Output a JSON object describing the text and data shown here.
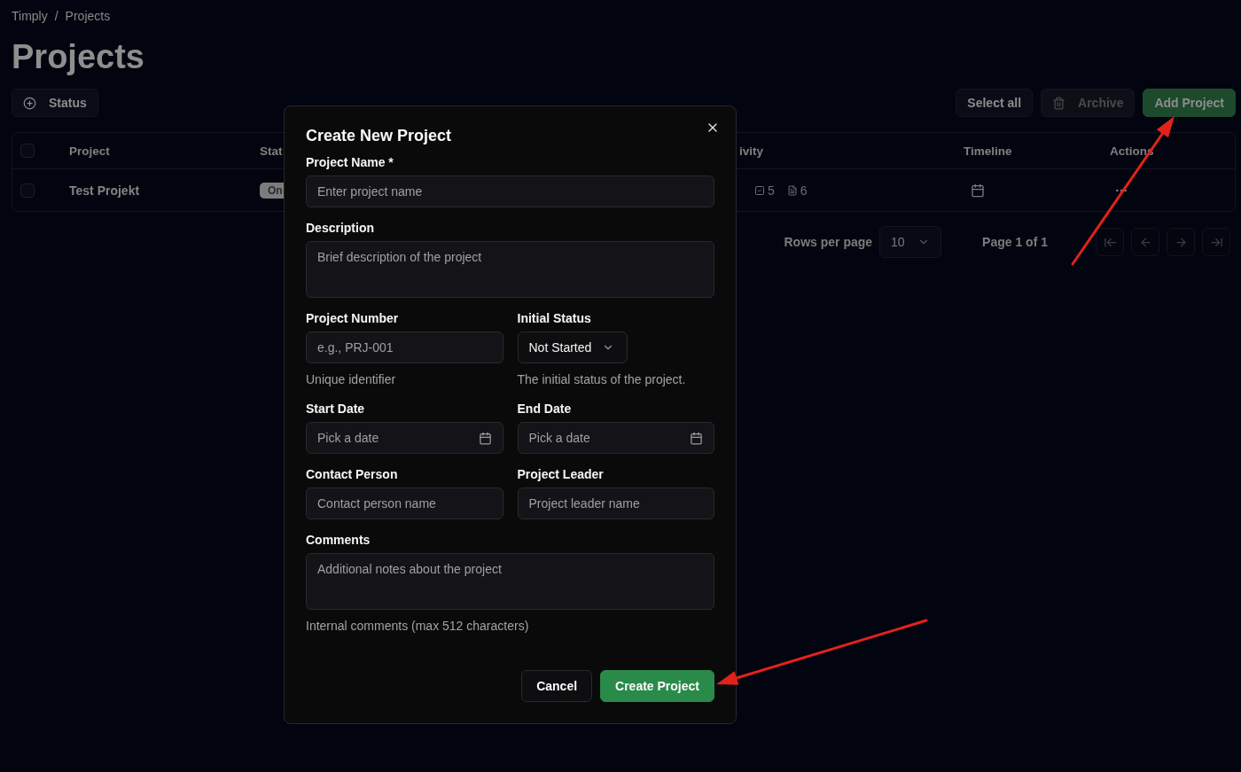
{
  "breadcrumb": {
    "items": [
      "Timply",
      "Projects"
    ],
    "separator": "/"
  },
  "page_title": "Projects",
  "toolbar": {
    "filter_button": "Status",
    "select_all": "Select all",
    "archive": {
      "label": "Archive",
      "disabled": true
    },
    "add_button": "Add Project"
  },
  "table": {
    "header_checked": false,
    "columns": [
      "Project",
      "Stat",
      "ivity",
      "Timeline",
      "Actions"
    ],
    "rows": [
      {
        "checked": false,
        "project": "Test Projekt",
        "status": "On",
        "tasks": "5",
        "documents": "6"
      }
    ]
  },
  "pagination": {
    "rows_per_page_label": "Rows per page",
    "rows_per_page": "10",
    "page_info": "Page 1 of 1"
  },
  "dialog": {
    "title": "Create New Project",
    "rows": [
      {
        "fields": [
          {
            "kind": "input",
            "label": "Project Name *",
            "placeholder": "Enter project name"
          }
        ]
      },
      {
        "fields": [
          {
            "kind": "textarea",
            "label": "Description",
            "placeholder": "Brief description of the project"
          }
        ]
      },
      {
        "fields": [
          {
            "kind": "input",
            "label": "Project Number",
            "placeholder": "e.g., PRJ-001",
            "helper": "Unique identifier"
          },
          {
            "kind": "select",
            "label": "Initial Status",
            "value": "Not Started",
            "helper": "The initial status of the project."
          }
        ]
      },
      {
        "fields": [
          {
            "kind": "date",
            "label": "Start Date",
            "placeholder": "Pick a date"
          },
          {
            "kind": "date",
            "label": "End Date",
            "placeholder": "Pick a date"
          }
        ]
      },
      {
        "fields": [
          {
            "kind": "input",
            "label": "Contact Person",
            "placeholder": "Contact person name"
          },
          {
            "kind": "input",
            "label": "Project Leader",
            "placeholder": "Project leader name"
          }
        ]
      },
      {
        "fields": [
          {
            "kind": "textarea",
            "label": "Comments",
            "placeholder": "Additional notes about the project",
            "helper": "Internal comments (max 512 characters)"
          }
        ]
      }
    ],
    "cancel": "Cancel",
    "submit": "Create Project"
  }
}
